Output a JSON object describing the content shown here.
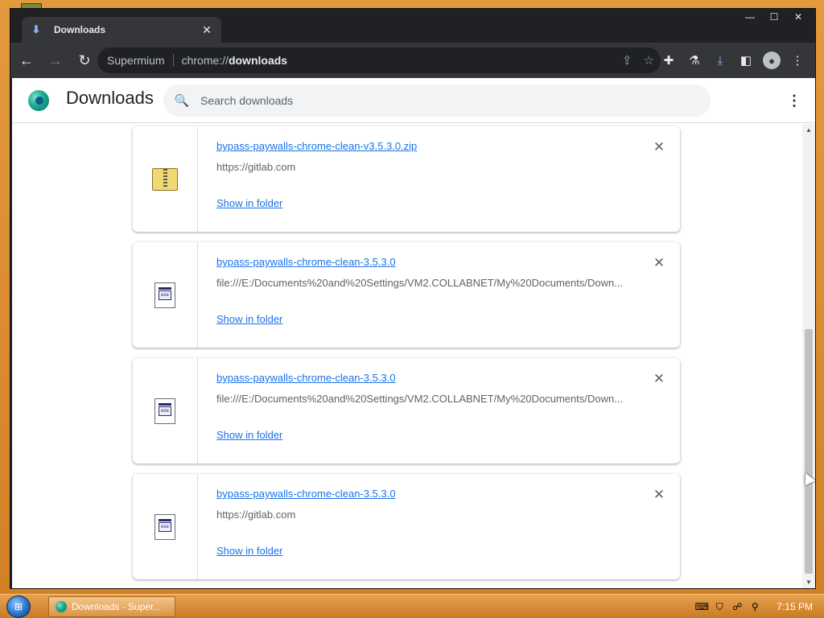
{
  "browser": {
    "tab_title": "Downloads",
    "site_name": "Supermium",
    "url_scheme": "chrome://",
    "url_host": "downloads"
  },
  "page": {
    "title": "Downloads",
    "search_placeholder": "Search downloads"
  },
  "downloads": [
    {
      "file_name": "bypass-paywalls-chrome-clean-v3.5.3.0.zip",
      "source": "https://gitlab.com",
      "action": "Show in folder",
      "icon": "zip-file-icon"
    },
    {
      "file_name": "bypass-paywalls-chrome-clean-3.5.3.0",
      "source": "file:///E:/Documents%20and%20Settings/VM2.COLLABNET/My%20Documents/Down...",
      "action": "Show in folder",
      "icon": "application-file-icon"
    },
    {
      "file_name": "bypass-paywalls-chrome-clean-3.5.3.0",
      "source": "file:///E:/Documents%20and%20Settings/VM2.COLLABNET/My%20Documents/Down...",
      "action": "Show in folder",
      "icon": "application-file-icon"
    },
    {
      "file_name": "bypass-paywalls-chrome-clean-3.5.3.0",
      "source": "https://gitlab.com",
      "action": "Show in folder",
      "icon": "application-file-icon"
    }
  ],
  "taskbar": {
    "task_label": "Downloads - Super...",
    "clock": "7:15 PM"
  },
  "colors": {
    "link": "#1a73e8",
    "chrome_dark": "#35363a",
    "taskbar": "#d68a2e"
  }
}
